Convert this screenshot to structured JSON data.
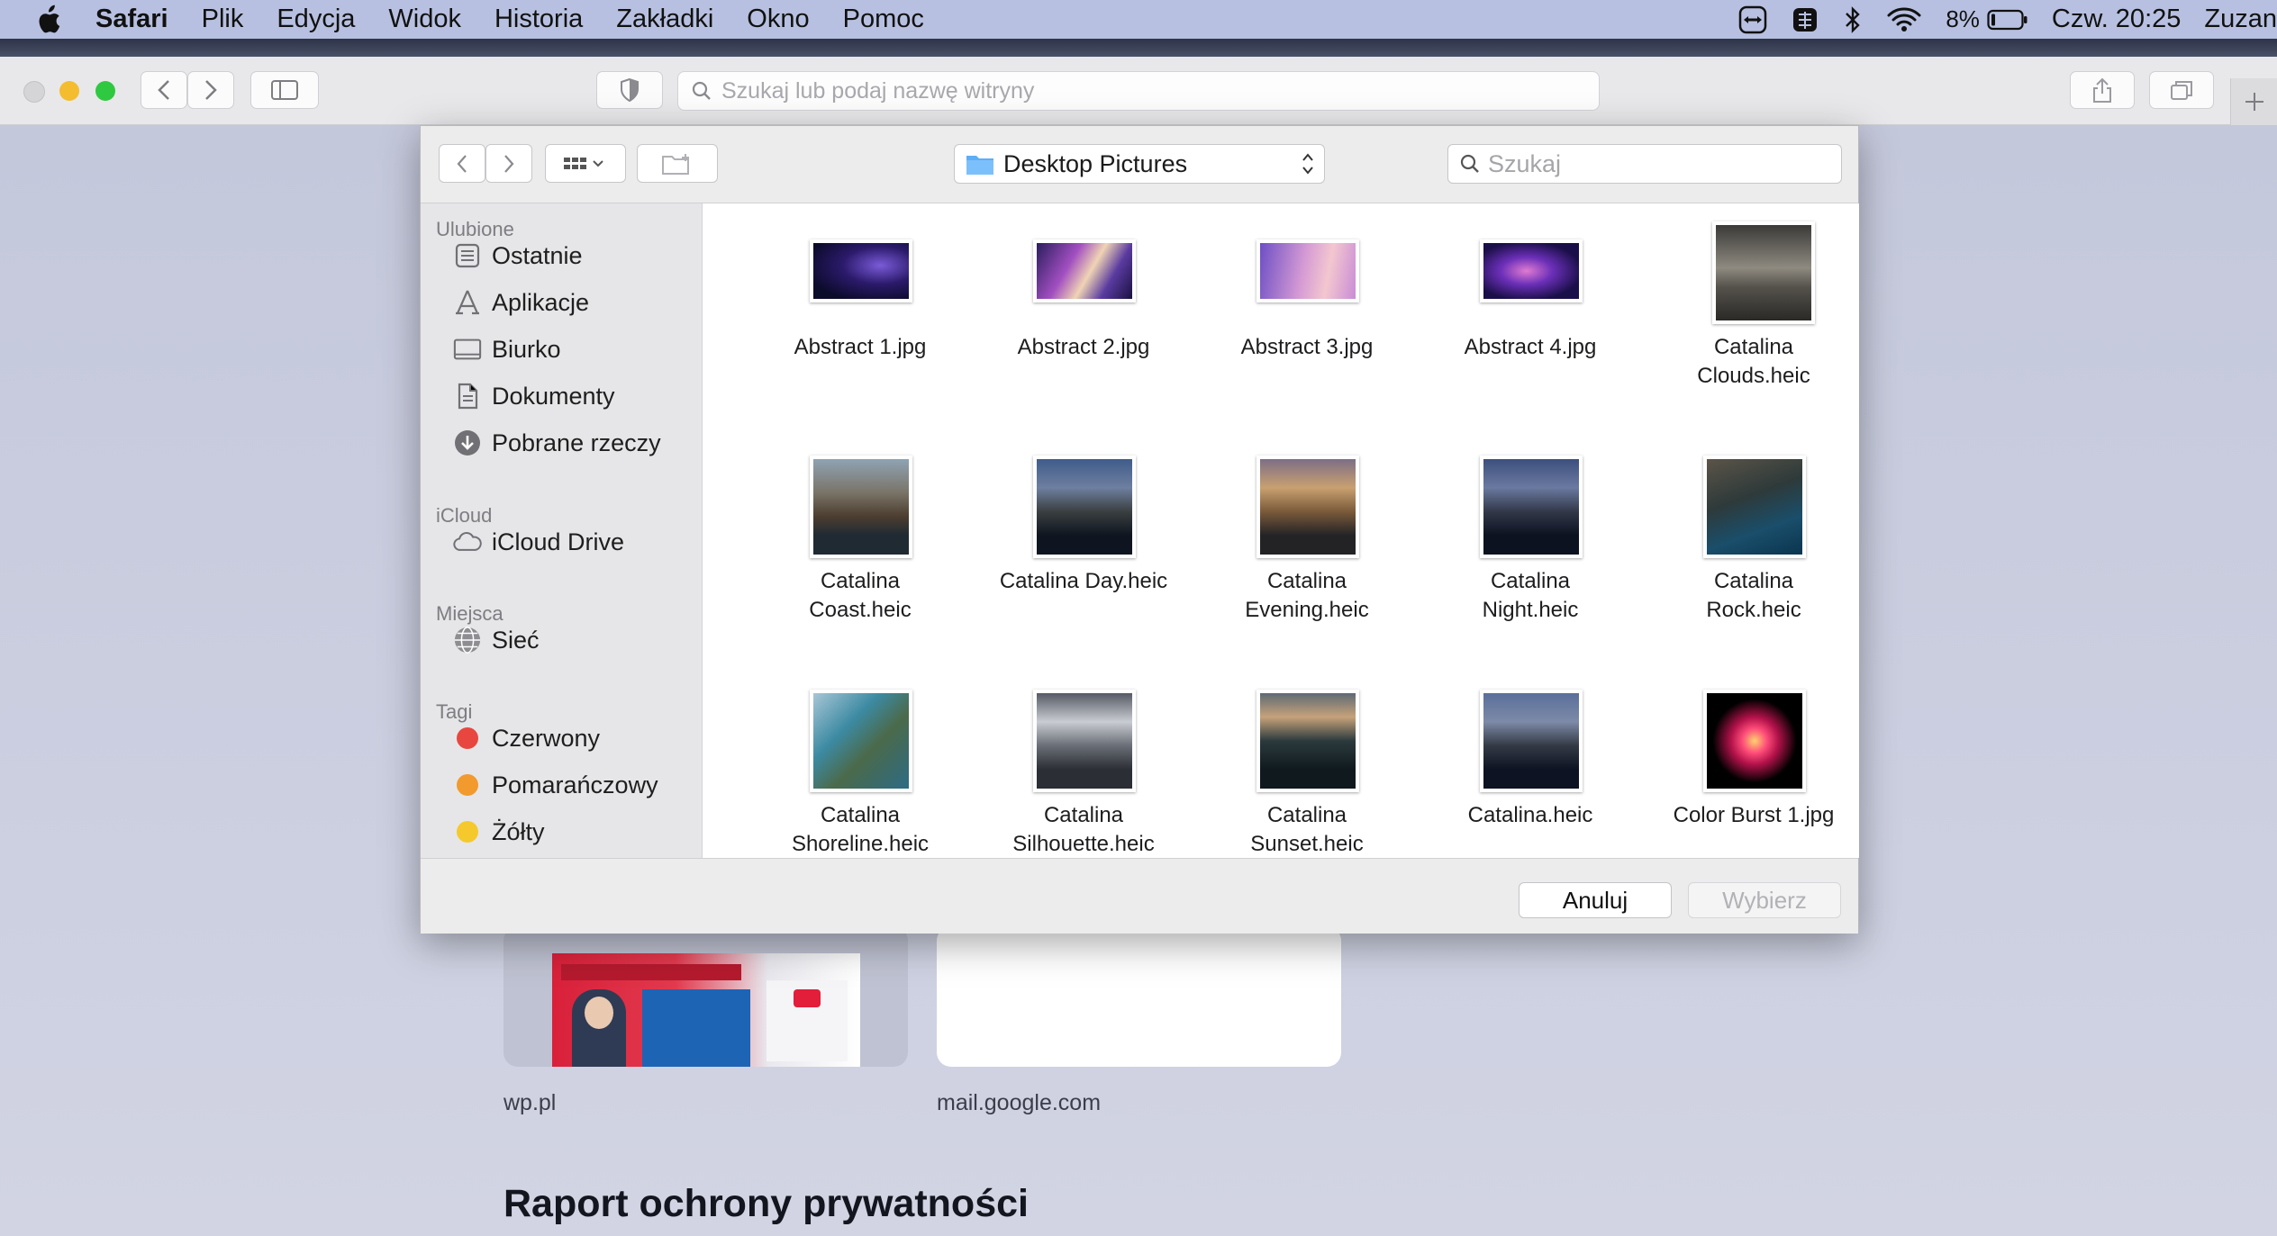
{
  "menubar": {
    "app": "Safari",
    "items": [
      "Plik",
      "Edycja",
      "Widok",
      "Historia",
      "Zakładki",
      "Okno",
      "Pomoc"
    ],
    "battery": "8%",
    "clock": "Czw. 20:25",
    "user": "Zuzan"
  },
  "browser": {
    "url_placeholder": "Szukaj lub podaj nazwę witryny"
  },
  "favorites": [
    {
      "label": "wp.pl"
    },
    {
      "label": "mail.google.com"
    }
  ],
  "privacy_title": "Raport ochrony prywatności",
  "dialog": {
    "location": "Desktop Pictures",
    "search_placeholder": "Szukaj",
    "sidebar": {
      "favorites_title": "Ulubione",
      "favorites": [
        "Ostatnie",
        "Aplikacje",
        "Biurko",
        "Dokumenty",
        "Pobrane rzeczy"
      ],
      "icloud_title": "iCloud",
      "icloud": [
        "iCloud Drive"
      ],
      "places_title": "Miejsca",
      "places": [
        "Sieć"
      ],
      "tags_title": "Tagi",
      "tags": [
        {
          "label": "Czerwony",
          "color": "#e8473f"
        },
        {
          "label": "Pomarańczowy",
          "color": "#f29a2e"
        },
        {
          "label": "Żółty",
          "color": "#f5c92c"
        }
      ]
    },
    "files": [
      {
        "l1": "Abstract 1.jpg",
        "l2": ""
      },
      {
        "l1": "Abstract 2.jpg",
        "l2": ""
      },
      {
        "l1": "Abstract 3.jpg",
        "l2": ""
      },
      {
        "l1": "Abstract 4.jpg",
        "l2": ""
      },
      {
        "l1": "Catalina",
        "l2": "Clouds.heic"
      },
      {
        "l1": "Catalina",
        "l2": "Coast.heic"
      },
      {
        "l1": "Catalina Day.heic",
        "l2": ""
      },
      {
        "l1": "Catalina",
        "l2": "Evening.heic"
      },
      {
        "l1": "Catalina",
        "l2": "Night.heic"
      },
      {
        "l1": "Catalina",
        "l2": "Rock.heic"
      },
      {
        "l1": "Catalina",
        "l2": "Shoreline.heic"
      },
      {
        "l1": "Catalina",
        "l2": "Silhouette.heic"
      },
      {
        "l1": "Catalina",
        "l2": "Sunset.heic"
      },
      {
        "l1": "Catalina.heic",
        "l2": ""
      },
      {
        "l1": "Color Burst 1.jpg",
        "l2": ""
      }
    ],
    "cancel": "Anuluj",
    "choose": "Wybierz"
  }
}
